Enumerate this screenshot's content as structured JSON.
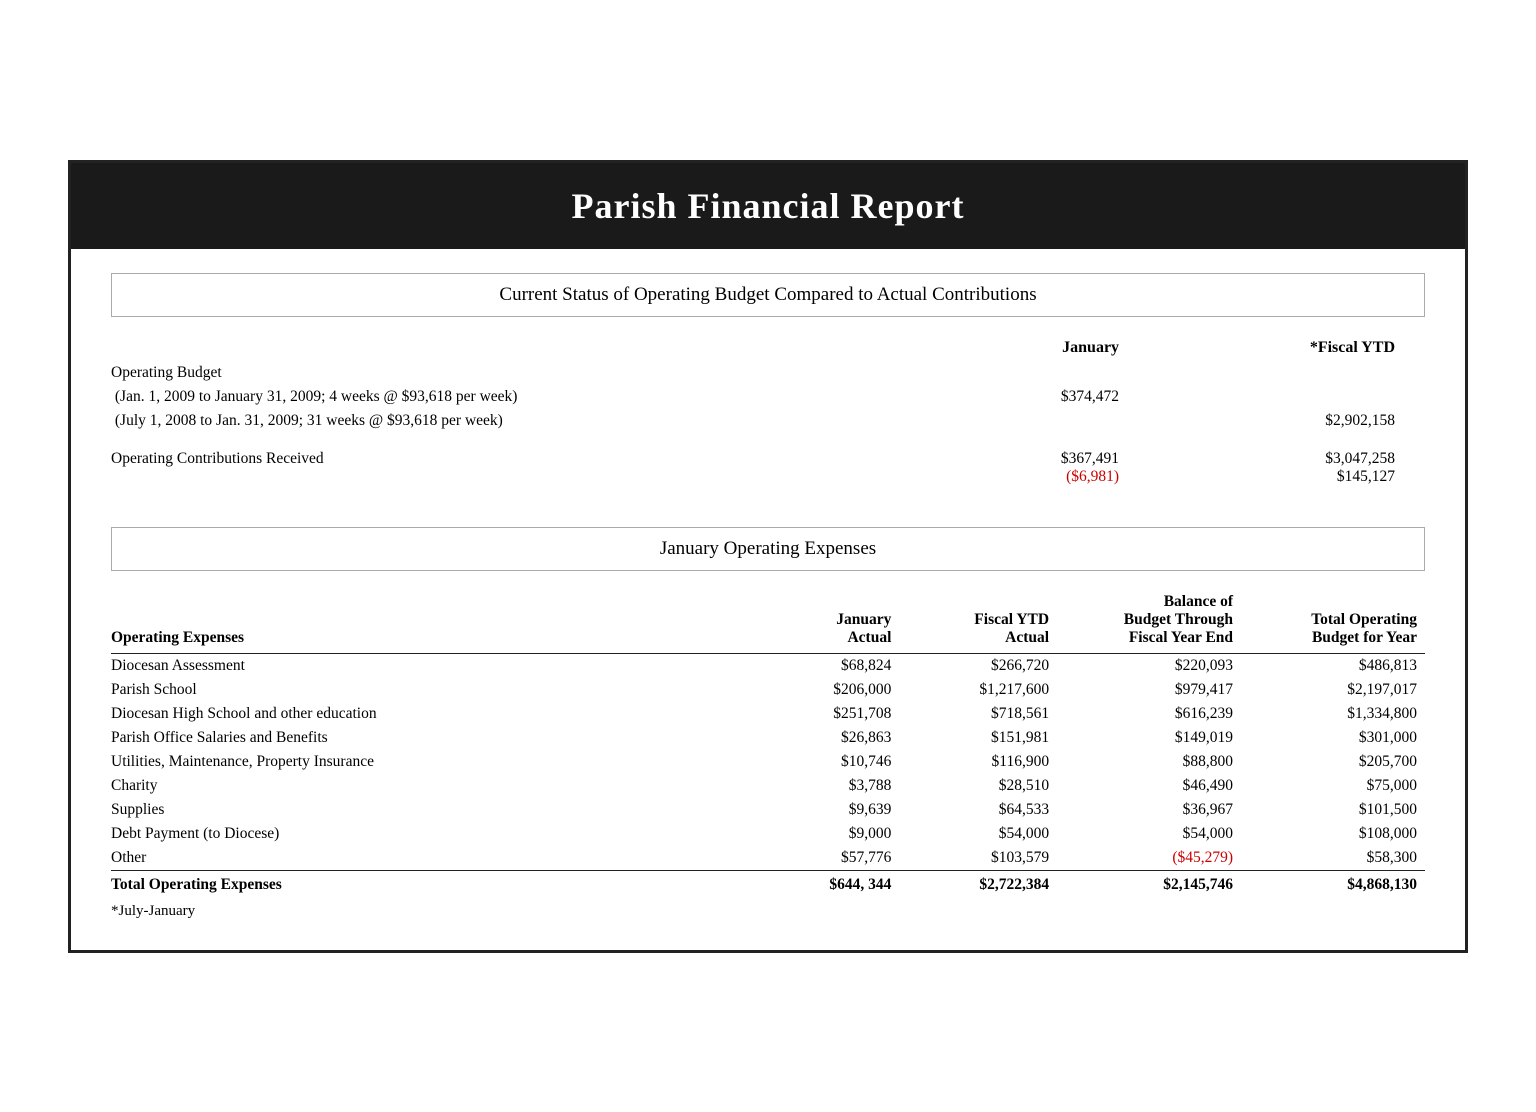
{
  "header": {
    "title": "Parish Financial Report"
  },
  "operating_budget_section": {
    "title": "Current Status of Operating Budget Compared to Actual Contributions",
    "col_january": "January",
    "col_fiscal_ytd": "*Fiscal YTD",
    "rows": [
      {
        "label": "Operating Budget",
        "sub1": " (Jan. 1, 2009 to January 31, 2009; 4 weeks @ $93,618 per week)",
        "sub2": " (July 1, 2008 to Jan. 31, 2009; 31 weeks @ $93,618 per week)",
        "jan_val": "$374,472",
        "ytd_val": "",
        "ytd_val2": "$2,902,158"
      }
    ],
    "contributions_label": "Operating Contributions Received",
    "contributions_jan": "$367,491",
    "contributions_jan_diff": "($6,981)",
    "contributions_ytd": "$3,047,258",
    "contributions_ytd_diff": "$145,127"
  },
  "expenses_section": {
    "title": "January Operating Expenses",
    "col_label": "Operating Expenses",
    "col_jan_actual": "January\nActual",
    "col_ytd_actual": "Fiscal YTD\nActual",
    "col_balance": "Balance of\nBudget Through\nFiscal Year End",
    "col_total": "Total Operating\nBudget for Year",
    "rows": [
      {
        "label": "Diocesan Assessment",
        "jan": "$68,824",
        "ytd": "$266,720",
        "bal": "$220,093",
        "total": "$486,813",
        "bal_red": false
      },
      {
        "label": "Parish School",
        "jan": "$206,000",
        "ytd": "$1,217,600",
        "bal": "$979,417",
        "total": "$2,197,017",
        "bal_red": false
      },
      {
        "label": "Diocesan High School and other education",
        "jan": "$251,708",
        "ytd": "$718,561",
        "bal": "$616,239",
        "total": "$1,334,800",
        "bal_red": false
      },
      {
        "label": "Parish Office Salaries and Benefits",
        "jan": "$26,863",
        "ytd": "$151,981",
        "bal": "$149,019",
        "total": "$301,000",
        "bal_red": false
      },
      {
        "label": "Utilities, Maintenance, Property Insurance",
        "jan": "$10,746",
        "ytd": "$116,900",
        "bal": "$88,800",
        "total": "$205,700",
        "bal_red": false
      },
      {
        "label": "Charity",
        "jan": "$3,788",
        "ytd": "$28,510",
        "bal": "$46,490",
        "total": "$75,000",
        "bal_red": false
      },
      {
        "label": "Supplies",
        "jan": "$9,639",
        "ytd": "$64,533",
        "bal": "$36,967",
        "total": "$101,500",
        "bal_red": false
      },
      {
        "label": "Debt Payment (to Diocese)",
        "jan": "$9,000",
        "ytd": "$54,000",
        "bal": "$54,000",
        "total": "$108,000",
        "bal_red": false
      },
      {
        "label": "Other",
        "jan": "$57,776",
        "ytd": "$103,579",
        "bal": "($45,279)",
        "total": "$58,300",
        "bal_red": true
      }
    ],
    "total_row": {
      "label": "Total Operating Expenses",
      "jan": "$644, 344",
      "ytd": "$2,722,384",
      "bal": "$2,145,746",
      "total": "$4,868,130"
    },
    "footnote": "*July-January"
  }
}
